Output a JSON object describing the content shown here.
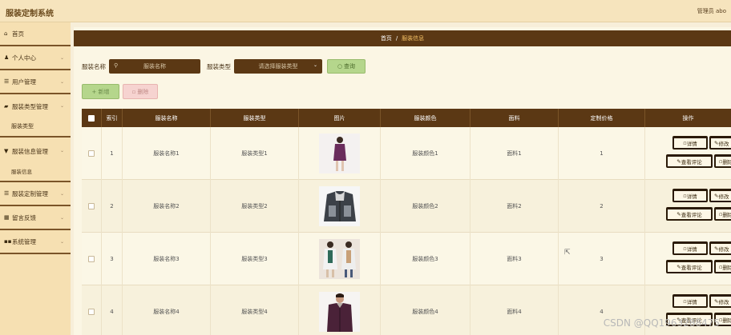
{
  "app": {
    "title": "服装定制系统",
    "user": "管理员 abo"
  },
  "sidebar": {
    "items": [
      {
        "label": "首页",
        "icon": "home-icon",
        "glyph": "⌂"
      },
      {
        "label": "个人中心",
        "icon": "user-icon",
        "glyph": "♟"
      },
      {
        "label": "用户管理",
        "icon": "list-icon",
        "glyph": "☰"
      },
      {
        "label": "服装类型管理",
        "icon": "folder-icon",
        "glyph": "▰"
      },
      {
        "label": "服装信息管理",
        "icon": "tag-icon",
        "glyph": "▼"
      },
      {
        "label": "服装定制管理",
        "icon": "list-icon",
        "glyph": "☰"
      },
      {
        "label": "留言反馈",
        "icon": "grid-icon",
        "glyph": "▦"
      },
      {
        "label": "系统管理",
        "icon": "settings-icon",
        "glyph": "▪▪"
      }
    ],
    "sub_clothing_type": "服装类型",
    "sub_clothing_info": "服装信息"
  },
  "breadcrumb": {
    "home": "首页",
    "separator": "/",
    "current": "服装信息"
  },
  "search": {
    "name_label": "服装名称",
    "name_placeholder": "服装名称",
    "type_label": "服装类型",
    "type_placeholder": "请选择服装类型",
    "query_button": "查询"
  },
  "actions": {
    "add": "+ 新增",
    "delete": "删除"
  },
  "table": {
    "columns": [
      "索引",
      "服装名称",
      "服装类型",
      "图片",
      "服装颜色",
      "面料",
      "定制价格",
      "操作"
    ],
    "rows": [
      {
        "index": "1",
        "name": "服装名称1",
        "type": "服装类型1",
        "color": "服装颜色1",
        "fabric": "面料1",
        "price": "1"
      },
      {
        "index": "2",
        "name": "服装名称2",
        "type": "服装类型2",
        "color": "服装颜色2",
        "fabric": "面料2",
        "price": "2"
      },
      {
        "index": "3",
        "name": "服装名称3",
        "type": "服装类型3",
        "color": "服装颜色3",
        "fabric": "面料3",
        "price": "3"
      },
      {
        "index": "4",
        "name": "服装名称4",
        "type": "服装类型4",
        "color": "服装颜色4",
        "fabric": "面料4",
        "price": "4"
      }
    ],
    "op_labels": {
      "detail": "详情",
      "edit": "修改",
      "comments": "查看评论",
      "delete": "删除"
    }
  },
  "watermark": "CSDN @QQ1963288475"
}
